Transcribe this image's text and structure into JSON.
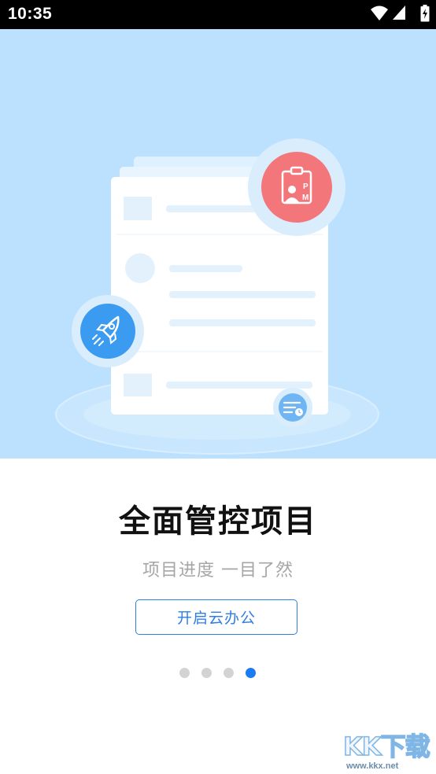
{
  "status_bar": {
    "time": "10:35",
    "icons": [
      "wifi-icon",
      "signal-icon",
      "battery-charging-icon"
    ]
  },
  "hero": {
    "illustration": "document-list-with-rocket-and-project-manager-badges",
    "pm_badge_text": [
      "P",
      "M"
    ],
    "colors": {
      "background": "#bce1fe",
      "rocket_badge": "#3a9bf0",
      "pm_badge": "#f2767a"
    }
  },
  "onboarding": {
    "title": "全面管控项目",
    "subtitle": "项目进度 一目了然",
    "cta_label": "开启云办公",
    "page_count": 4,
    "active_page": 4
  },
  "watermark": {
    "logo": "KK下载",
    "url": "www.kkx.net"
  },
  "colors": {
    "accent": "#2f7ee3",
    "dot_active": "#1a7cf3",
    "dot_inactive": "#d3d3d3"
  }
}
